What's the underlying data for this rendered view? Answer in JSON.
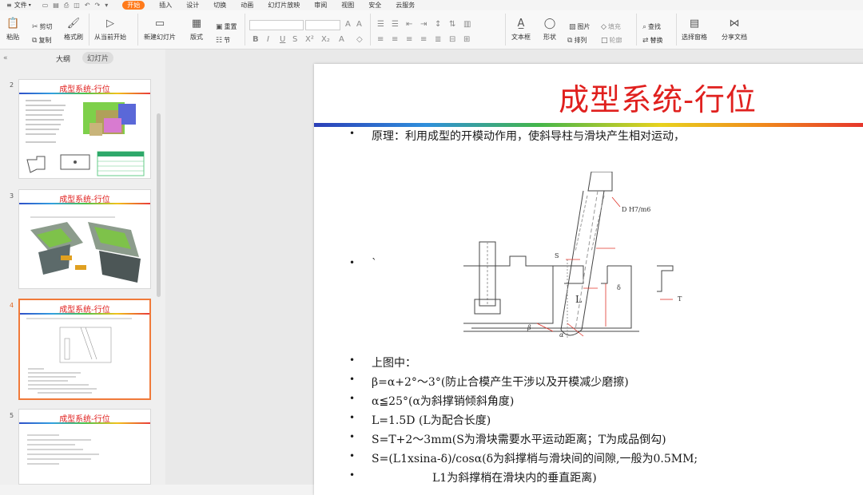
{
  "menubar": {
    "file_menu": "文件",
    "tabs": [
      {
        "label": "开始",
        "active": true
      },
      {
        "label": "插入",
        "active": false
      },
      {
        "label": "设计",
        "active": false
      },
      {
        "label": "切换",
        "active": false
      },
      {
        "label": "动画",
        "active": false
      },
      {
        "label": "幻灯片放映",
        "active": false
      },
      {
        "label": "审阅",
        "active": false
      },
      {
        "label": "视图",
        "active": false
      },
      {
        "label": "安全",
        "active": false
      },
      {
        "label": "云服务",
        "active": false
      }
    ]
  },
  "ribbon": {
    "paste": "粘贴",
    "cut": "剪切",
    "copy": "复制",
    "format_painter": "格式刷",
    "from_current": "从当前开始",
    "new_slide": "新建幻灯片",
    "layout": "版式",
    "section": "节",
    "reset": "重置",
    "textbox": "文本框",
    "shape": "形状",
    "arrange": "排列",
    "picture": "图片",
    "fill": "填充",
    "outline": "轮廓",
    "find": "查找",
    "replace": "替换",
    "select_pane": "选择窗格",
    "share": "分享文档",
    "accent_color": "#ff7a1a"
  },
  "left_panel": {
    "tab_outline": "大纲",
    "tab_slides": "幻灯片",
    "slides": [
      {
        "number": "2",
        "title": "成型系统-行位",
        "selected": false
      },
      {
        "number": "3",
        "title": "成型系统-行位",
        "selected": false
      },
      {
        "number": "4",
        "title": "成型系统-行位",
        "selected": true
      },
      {
        "number": "5",
        "title": "成型系统-行位",
        "selected": false
      }
    ]
  },
  "slide": {
    "title": "成型系统-行位",
    "title_color": "#e0201e",
    "bullets": [
      {
        "dot": "•",
        "text": "原理：利用成型的开模动作用，使斜导柱与滑块产生相对运动，"
      },
      {
        "dot": "•",
        "text": "`"
      },
      {
        "dot": "•",
        "text": "上图中："
      },
      {
        "dot": "•",
        "text": "β=α+2°～3°(防止合模产生干涉以及开模减少磨擦)"
      },
      {
        "dot": "•",
        "text": "α≦25°(α为斜撑销倾斜角度)"
      },
      {
        "dot": "•",
        "text": "L=1.5D  (L为配合长度)"
      },
      {
        "dot": "•",
        "text": "S=T+2～3mm(S为滑块需要水平运动距离；T为成品倒勾)"
      },
      {
        "dot": "•",
        "text": "S=(L1xsina-δ)/cosα(δ为斜撑梢与滑块间的间隙,一般为0.5MM;"
      },
      {
        "dot": "•",
        "text": "L1为斜撑梢在滑块内的垂直距离)"
      }
    ],
    "diagram_labels": {
      "fit": "D H7/m6",
      "s": "S",
      "l": "L",
      "delta": "δ",
      "t": "T",
      "beta": "β",
      "alpha": "α"
    }
  }
}
